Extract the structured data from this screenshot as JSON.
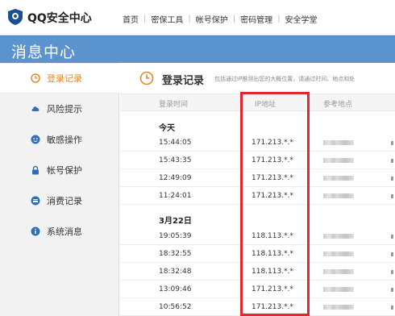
{
  "header": {
    "brand": "QQ安全中心",
    "nav": [
      "首页",
      "密保工具",
      "帐号保护",
      "密码管理",
      "安全学堂"
    ],
    "logo_color": "#1d4e8f"
  },
  "banner": {
    "title": "消息中心",
    "color": "#5b93cf"
  },
  "sidebar": {
    "items": [
      {
        "label": "登录记录",
        "icon": "clock-icon",
        "active": true
      },
      {
        "label": "风险提示",
        "icon": "cloud-icon"
      },
      {
        "label": "敏感操作",
        "icon": "smile-icon"
      },
      {
        "label": "帐号保护",
        "icon": "lock-icon"
      },
      {
        "label": "消费记录",
        "icon": "card-icon"
      },
      {
        "label": "系统消息",
        "icon": "info-icon"
      }
    ],
    "active_color": "#e08a2c"
  },
  "main": {
    "section_title": "登录记录",
    "section_desc": "包括通过IP推测出您的大概位置，请通过时间、地点和处",
    "columns": [
      "登录时间",
      "IP地址",
      "参考地点"
    ],
    "groups": [
      {
        "label": "今天",
        "rows": [
          {
            "time": "15:44:05",
            "ip": "171.213.*.*"
          },
          {
            "time": "15:43:35",
            "ip": "171.213.*.*"
          },
          {
            "time": "12:49:09",
            "ip": "171.213.*.*"
          },
          {
            "time": "11:24:01",
            "ip": "171.213.*.*"
          }
        ]
      },
      {
        "label": "3月22日",
        "rows": [
          {
            "time": "19:05:39",
            "ip": "118.113.*.*"
          },
          {
            "time": "18:32:55",
            "ip": "118.113.*.*"
          },
          {
            "time": "18:32:48",
            "ip": "118.113.*.*"
          },
          {
            "time": "13:09:46",
            "ip": "171.213.*.*"
          },
          {
            "time": "10:56:52",
            "ip": "171.213.*.*"
          }
        ]
      }
    ],
    "highlight_color": "#e0282d"
  }
}
